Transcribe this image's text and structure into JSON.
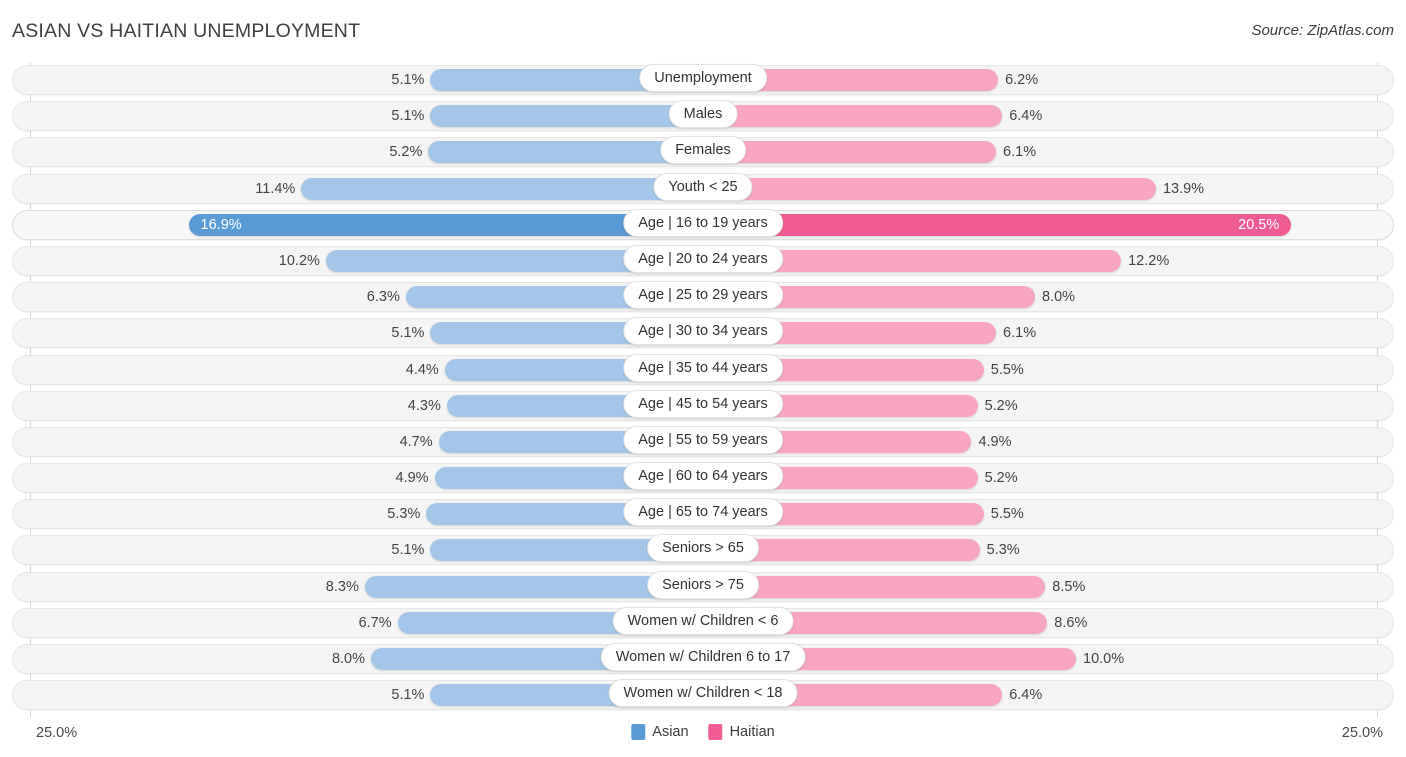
{
  "header": {
    "title": "ASIAN VS HAITIAN UNEMPLOYMENT",
    "source": "Source: ZipAtlas.com"
  },
  "axis": {
    "left_label": "25.0%",
    "right_label": "25.0%",
    "max": 25.0
  },
  "legend": {
    "items": [
      {
        "label": "Asian",
        "color": "#5b9bd5"
      },
      {
        "label": "Haitian",
        "color": "#ef5b93"
      }
    ]
  },
  "colors": {
    "asian_normal": "#a3c6e8",
    "asian_highlight": "#5b9bd5",
    "haitian_normal": "#f7a5c2",
    "haitian_highlight": "#ef5b93",
    "track": "#f4f4f4"
  },
  "chart_data": {
    "type": "bar",
    "title": "ASIAN VS HAITIAN UNEMPLOYMENT",
    "xlabel": "",
    "ylabel": "",
    "orientation": "horizontal-diverging",
    "xlim": [
      25.0,
      25.0
    ],
    "grid": false,
    "legend_position": "bottom-center",
    "categories": [
      "Unemployment",
      "Males",
      "Females",
      "Youth < 25",
      "Age | 16 to 19 years",
      "Age | 20 to 24 years",
      "Age | 25 to 29 years",
      "Age | 30 to 34 years",
      "Age | 35 to 44 years",
      "Age | 45 to 54 years",
      "Age | 55 to 59 years",
      "Age | 60 to 64 years",
      "Age | 65 to 74 years",
      "Seniors > 65",
      "Seniors > 75",
      "Women w/ Children < 6",
      "Women w/ Children 6 to 17",
      "Women w/ Children < 18"
    ],
    "series": [
      {
        "name": "Asian",
        "color": "#a3c6e8",
        "values": [
          5.1,
          5.1,
          5.2,
          11.4,
          16.9,
          10.2,
          6.3,
          5.1,
          4.4,
          4.3,
          4.7,
          4.9,
          5.3,
          5.1,
          8.3,
          6.7,
          8.0,
          5.1
        ]
      },
      {
        "name": "Haitian",
        "color": "#f7a5c2",
        "values": [
          6.2,
          6.4,
          6.1,
          13.9,
          20.5,
          12.2,
          8.0,
          6.1,
          5.5,
          5.2,
          4.9,
          5.2,
          5.5,
          5.3,
          8.5,
          8.6,
          10.0,
          6.4
        ]
      }
    ]
  },
  "rows": [
    {
      "label": "Unemployment",
      "left": "5.1%",
      "right": "6.2%",
      "lv": 5.1,
      "rv": 6.2,
      "hl": false
    },
    {
      "label": "Males",
      "left": "5.1%",
      "right": "6.4%",
      "lv": 5.1,
      "rv": 6.4,
      "hl": false
    },
    {
      "label": "Females",
      "left": "5.2%",
      "right": "6.1%",
      "lv": 5.2,
      "rv": 6.1,
      "hl": false
    },
    {
      "label": "Youth < 25",
      "left": "11.4%",
      "right": "13.9%",
      "lv": 11.4,
      "rv": 13.9,
      "hl": false
    },
    {
      "label": "Age | 16 to 19 years",
      "left": "16.9%",
      "right": "20.5%",
      "lv": 16.9,
      "rv": 20.5,
      "hl": true
    },
    {
      "label": "Age | 20 to 24 years",
      "left": "10.2%",
      "right": "12.2%",
      "lv": 10.2,
      "rv": 12.2,
      "hl": false
    },
    {
      "label": "Age | 25 to 29 years",
      "left": "6.3%",
      "right": "8.0%",
      "lv": 6.3,
      "rv": 8.0,
      "hl": false
    },
    {
      "label": "Age | 30 to 34 years",
      "left": "5.1%",
      "right": "6.1%",
      "lv": 5.1,
      "rv": 6.1,
      "hl": false
    },
    {
      "label": "Age | 35 to 44 years",
      "left": "4.4%",
      "right": "5.5%",
      "lv": 4.4,
      "rv": 5.5,
      "hl": false
    },
    {
      "label": "Age | 45 to 54 years",
      "left": "4.3%",
      "right": "5.2%",
      "lv": 4.3,
      "rv": 5.2,
      "hl": false
    },
    {
      "label": "Age | 55 to 59 years",
      "left": "4.7%",
      "right": "4.9%",
      "lv": 4.7,
      "rv": 4.9,
      "hl": false
    },
    {
      "label": "Age | 60 to 64 years",
      "left": "4.9%",
      "right": "5.2%",
      "lv": 4.9,
      "rv": 5.2,
      "hl": false
    },
    {
      "label": "Age | 65 to 74 years",
      "left": "5.3%",
      "right": "5.5%",
      "lv": 5.3,
      "rv": 5.5,
      "hl": false
    },
    {
      "label": "Seniors > 65",
      "left": "5.1%",
      "right": "5.3%",
      "lv": 5.1,
      "rv": 5.3,
      "hl": false
    },
    {
      "label": "Seniors > 75",
      "left": "8.3%",
      "right": "8.5%",
      "lv": 8.3,
      "rv": 8.5,
      "hl": false
    },
    {
      "label": "Women w/ Children < 6",
      "left": "6.7%",
      "right": "8.6%",
      "lv": 6.7,
      "rv": 8.6,
      "hl": false
    },
    {
      "label": "Women w/ Children 6 to 17",
      "left": "8.0%",
      "right": "10.0%",
      "lv": 8.0,
      "rv": 10.0,
      "hl": false
    },
    {
      "label": "Women w/ Children < 18",
      "left": "5.1%",
      "right": "6.4%",
      "lv": 5.1,
      "rv": 6.4,
      "hl": false
    }
  ]
}
